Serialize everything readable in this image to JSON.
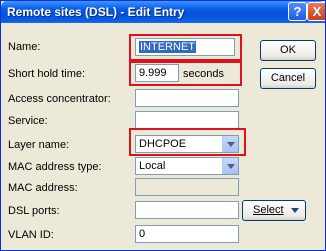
{
  "window": {
    "title": "Remote sites (DSL) - Edit Entry",
    "help_glyph": "?",
    "close_glyph": "X"
  },
  "form": {
    "name": {
      "label": "Name:",
      "value": "INTERNET"
    },
    "short_hold": {
      "label": "Short hold time:",
      "value": "9.999",
      "unit": "seconds"
    },
    "access_concentrator": {
      "label": "Access concentrator:",
      "value": ""
    },
    "service": {
      "label": "Service:",
      "value": ""
    },
    "layer_name": {
      "label": "Layer name:",
      "value": "DHCPOE"
    },
    "mac_type": {
      "label": "MAC address type:",
      "value": "Local"
    },
    "mac_address": {
      "label": "MAC address:",
      "value": ""
    },
    "dsl_ports": {
      "label": "DSL ports:",
      "value": "",
      "select_label": "Select"
    },
    "vlan_id": {
      "label": "VLAN ID:",
      "value": "0"
    }
  },
  "buttons": {
    "ok": "OK",
    "cancel": "Cancel"
  },
  "colors": {
    "highlight": "#e0101c",
    "selection": "#316ac5",
    "titlebar": "#0a5fe6"
  }
}
